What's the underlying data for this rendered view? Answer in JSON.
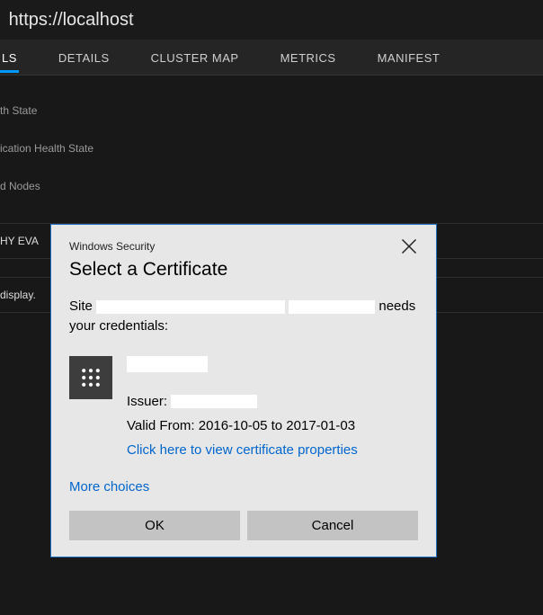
{
  "topbar": {
    "url_prefix": "https://localhost"
  },
  "tabs": [
    {
      "label": "LS",
      "active": true
    },
    {
      "label": "DETAILS"
    },
    {
      "label": "CLUSTER MAP"
    },
    {
      "label": "METRICS"
    },
    {
      "label": "MANIFEST"
    }
  ],
  "rows": [
    "th State",
    "ication Health State",
    "d Nodes"
  ],
  "section": {
    "left": "HY EVA",
    "right": "display."
  },
  "dialog": {
    "header": "Windows Security",
    "title": "Select a Certificate",
    "msg_pre": "Site ",
    "msg_post": " needs your credentials:",
    "issuer_label": "Issuer: ",
    "valid": "Valid From: 2016-10-05 to 2017-01-03",
    "view_link": "Click here to view certificate properties",
    "more": "More choices",
    "ok": "OK",
    "cancel": "Cancel"
  }
}
